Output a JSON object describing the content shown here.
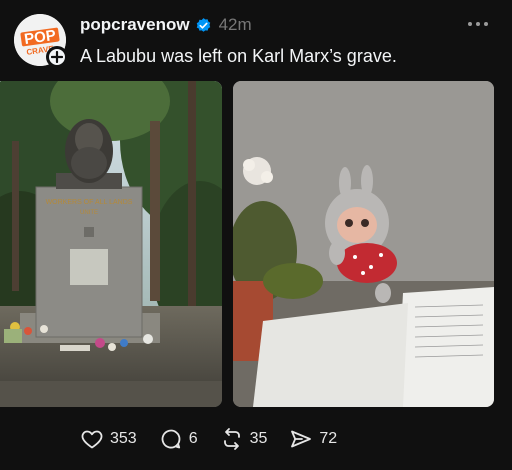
{
  "author": {
    "username": "popcravenow",
    "verified": true,
    "time_ago": "42m",
    "avatar_text_top": "POP",
    "avatar_text_bottom": "CRAVE"
  },
  "post": {
    "caption": "A Labubu was left on Karl Marx’s grave.",
    "images": [
      {
        "subject": "Karl Marx tomb with bust and flowers"
      },
      {
        "subject": "Labubu doll next to flowers and paper note"
      }
    ]
  },
  "actions": {
    "likes": "353",
    "replies": "6",
    "reposts": "35",
    "shares": "72"
  },
  "colors": {
    "background": "#101010",
    "text": "#f3f5f7",
    "muted": "#777777",
    "verified": "#0095f6",
    "brand_orange": "#f26a21"
  },
  "icons": [
    "verified-icon",
    "more-icon",
    "heart-icon",
    "reply-icon",
    "repost-icon",
    "share-icon",
    "plus-icon"
  ]
}
